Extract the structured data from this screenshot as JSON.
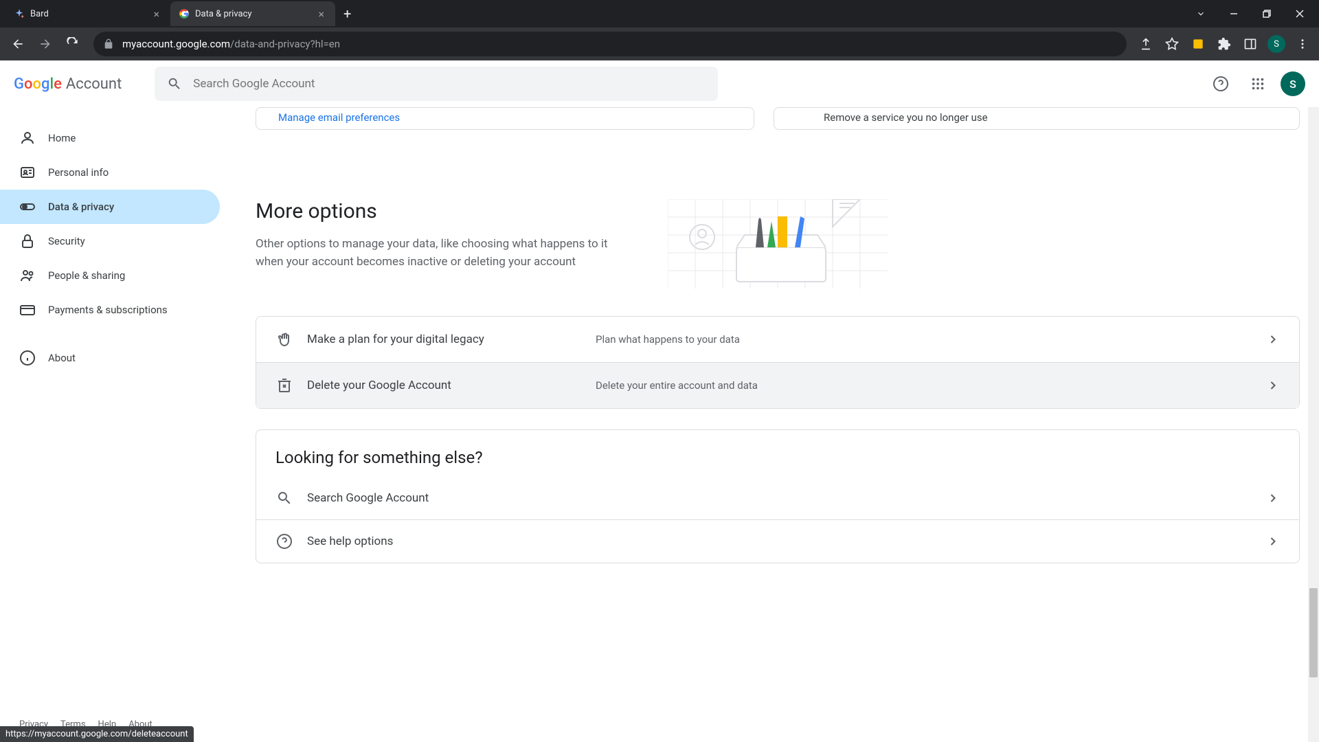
{
  "browser": {
    "tabs": [
      {
        "title": "Bard",
        "favicon_color": "#8ab4f8"
      },
      {
        "title": "Data & privacy",
        "favicon": "google"
      }
    ],
    "url_domain": "myaccount.google.com",
    "url_path": "/data-and-privacy?hl=en",
    "profile_letter": "S"
  },
  "header": {
    "logo_text": "Account",
    "search_placeholder": "Search Google Account",
    "avatar_letter": "S"
  },
  "sidebar": {
    "items": [
      {
        "label": "Home"
      },
      {
        "label": "Personal info"
      },
      {
        "label": "Data & privacy"
      },
      {
        "label": "Security"
      },
      {
        "label": "People & sharing"
      },
      {
        "label": "Payments & subscriptions"
      },
      {
        "label": "About"
      }
    ],
    "footer": [
      "Privacy",
      "Terms",
      "Help",
      "About"
    ]
  },
  "main": {
    "cutoff": {
      "left_link": "Manage email preferences",
      "right_text": "Remove a service you no longer use"
    },
    "section_title": "More options",
    "section_desc": "Other options to manage your data, like choosing what happens to it when your account becomes inactive or deleting your account",
    "options": [
      {
        "title": "Make a plan for your digital legacy",
        "desc": "Plan what happens to your data"
      },
      {
        "title": "Delete your Google Account",
        "desc": "Delete your entire account and data"
      }
    ],
    "looking_else": {
      "title": "Looking for something else?",
      "items": [
        {
          "title": "Search Google Account"
        },
        {
          "title": "See help options"
        }
      ]
    }
  },
  "status_bar": "https://myaccount.google.com/deleteaccount"
}
